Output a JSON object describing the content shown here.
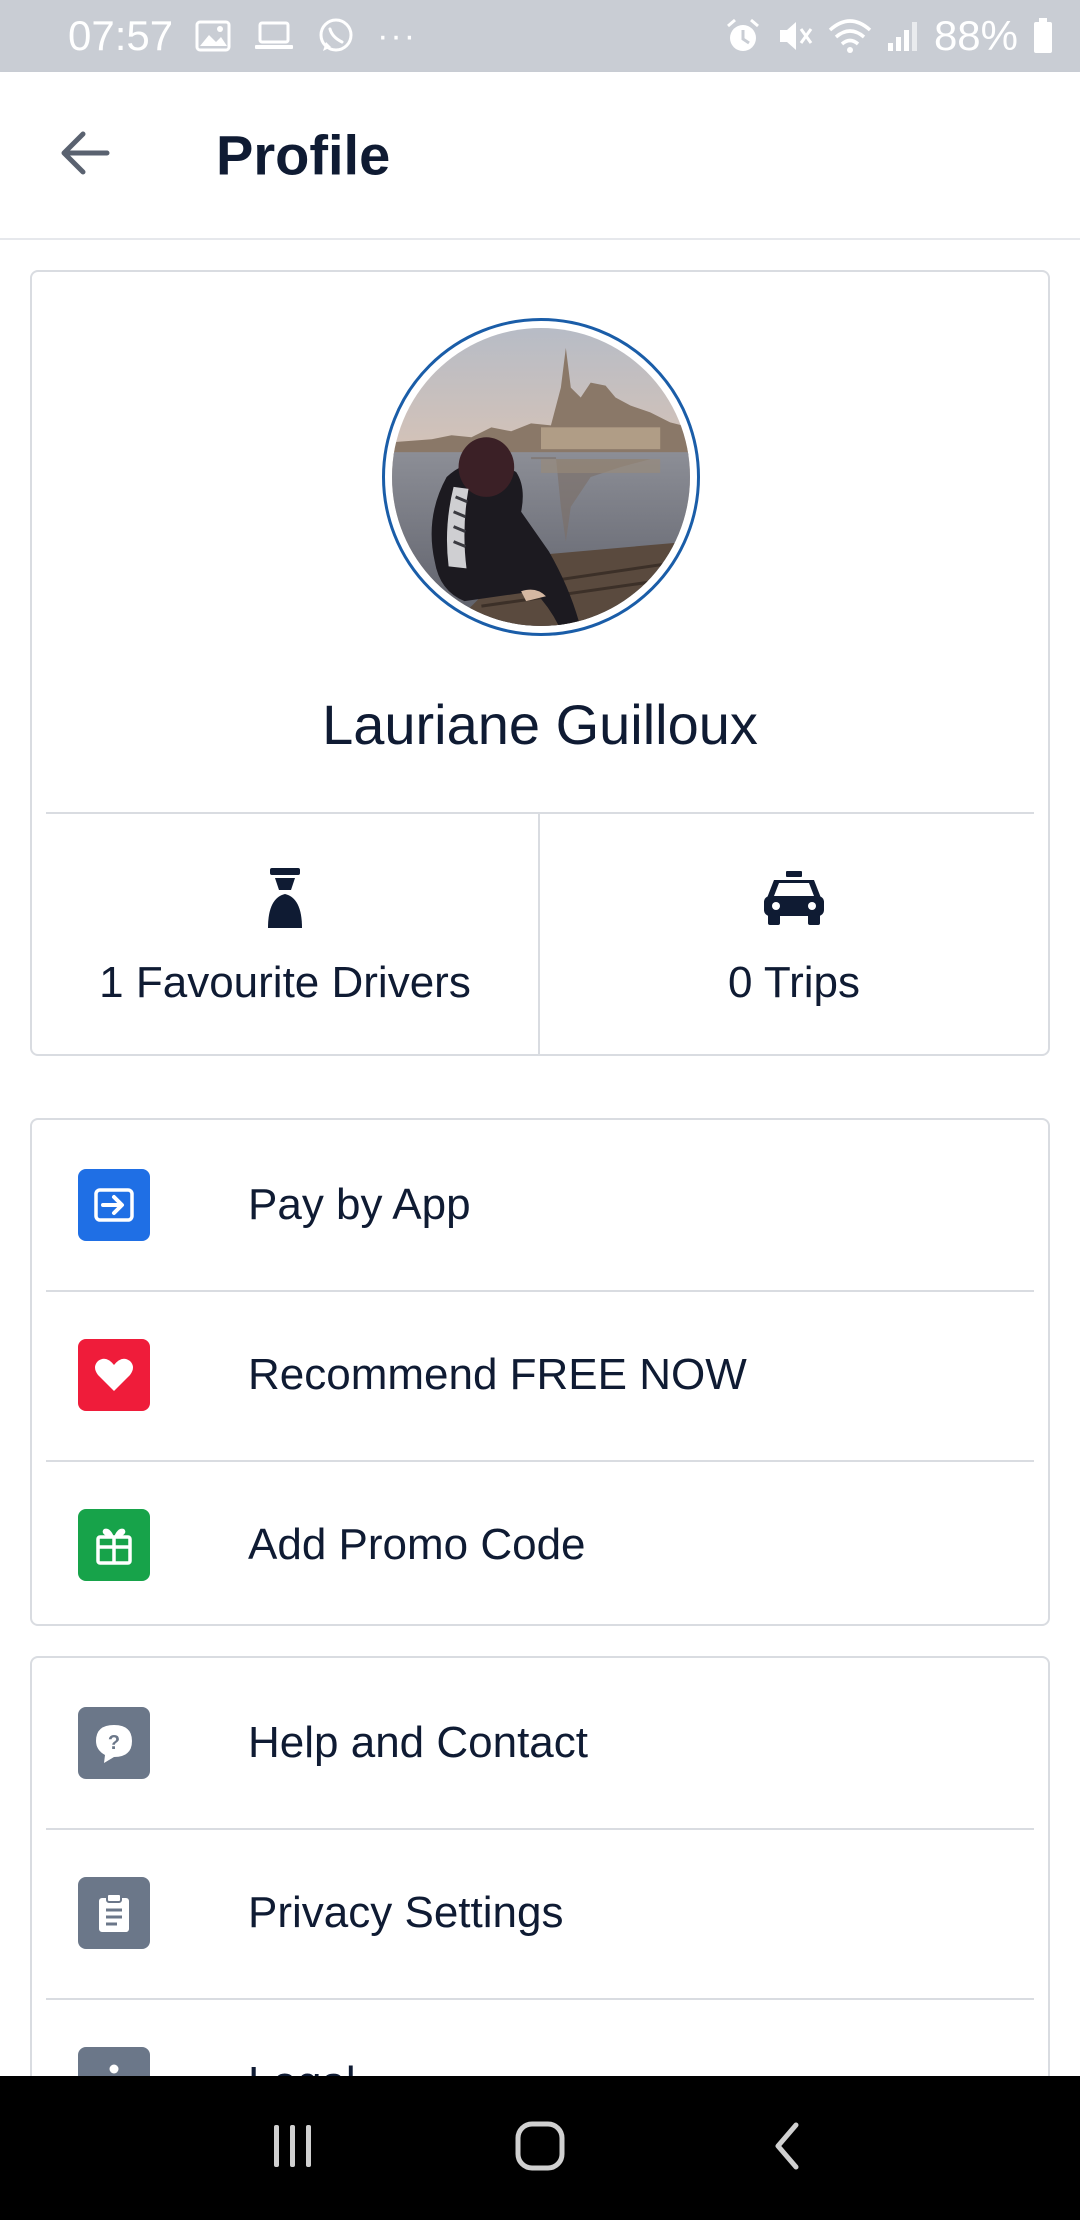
{
  "status_bar": {
    "time": "07:57",
    "more": "···",
    "battery_percent": "88%",
    "icons": [
      "image-icon",
      "laptop-icon",
      "whatsapp-icon",
      "alarm-icon",
      "mute-icon",
      "wifi-icon",
      "signal-icon",
      "battery-icon"
    ]
  },
  "app_bar": {
    "back_icon": "arrow-left-icon",
    "title": "Profile"
  },
  "profile": {
    "name": "Lauriane Guilloux",
    "accent_color": "#1a5da8",
    "stats": [
      {
        "icon": "driver-icon",
        "label": "1 Favourite Drivers"
      },
      {
        "icon": "taxi-icon",
        "label": "0 Trips"
      }
    ]
  },
  "menu_primary": [
    {
      "icon": "pay-by-app-icon",
      "color": "#1f6fe5",
      "label": "Pay by App"
    },
    {
      "icon": "heart-icon",
      "color": "#ef1c3a",
      "label": "Recommend FREE NOW"
    },
    {
      "icon": "gift-icon",
      "color": "#17a34a",
      "label": "Add Promo Code"
    }
  ],
  "menu_secondary": [
    {
      "icon": "help-chat-icon",
      "color": "#6b7789",
      "label": "Help and Contact"
    },
    {
      "icon": "clipboard-icon",
      "color": "#6b7789",
      "label": "Privacy Settings"
    },
    {
      "icon": "info-icon",
      "color": "#6b7789",
      "label": "Legal"
    }
  ],
  "nav_bar": {
    "buttons": [
      "recent-apps-icon",
      "home-icon",
      "back-nav-icon"
    ]
  }
}
